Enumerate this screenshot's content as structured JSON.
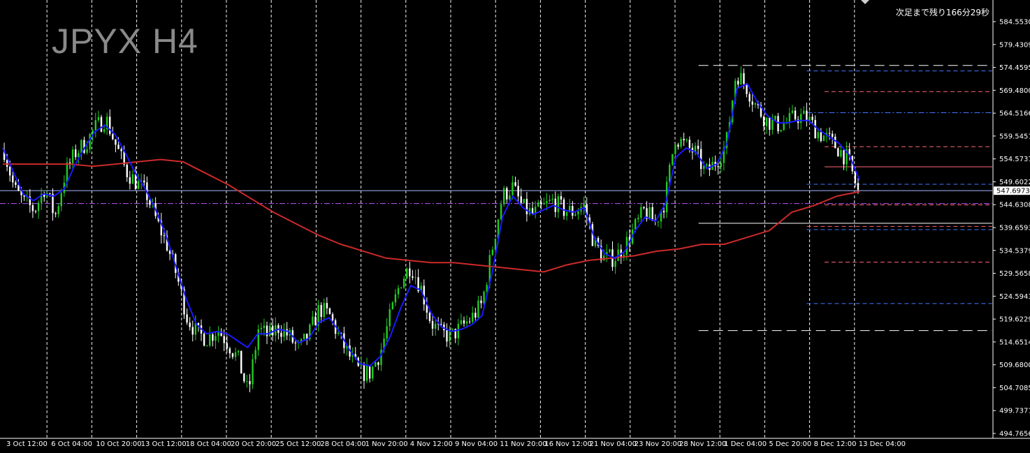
{
  "title": "JPYX H4",
  "countdown": "次足まで残り166分29秒",
  "colors": {
    "background": "#000000",
    "bull": "#22cc22",
    "bear": "#ffffff",
    "ma_fast": "#1a1aff",
    "ma_slow": "#cc2a2a",
    "grid": "#ffffff",
    "text": "#ffffff",
    "current_price_bg": "#ffffff"
  },
  "chart_data": {
    "type": "candlestick",
    "symbol": "JPYX",
    "timeframe": "H4",
    "x_labels": [
      "3 Oct 12:00",
      "6 Oct 04:00",
      "10 Oct 20:00",
      "13 Oct 12:00",
      "18 Oct 04:00",
      "20 Oct 20:00",
      "25 Oct 12:00",
      "28 Oct 04:00",
      "1 Nov 20:00",
      "4 Nov 12:00",
      "9 Nov 04:00",
      "11 Nov 20:00",
      "16 Nov 12:00",
      "21 Nov 04:00",
      "23 Nov 20:00",
      "28 Nov 12:00",
      "1 Dec 04:00",
      "5 Dec 20:00",
      "8 Dec 12:00",
      "13 Dec 04:00"
    ],
    "y_ticks": [
      "584.55305",
      "579.43095",
      "574.45950",
      "569.48005",
      "564.51660",
      "559.54515",
      "554.57370",
      "549.60225",
      "544.63080",
      "539.65935",
      "534.53795",
      "529.56580",
      "524.59435",
      "519.62290",
      "514.65145",
      "509.68000",
      "504.70855",
      "499.73710",
      "494.76565"
    ],
    "ylim": [
      494.76565,
      584.55305
    ],
    "current_price": "547.69739",
    "price_path": [
      556.5,
      548.0,
      545.0,
      543.5,
      548.5,
      542.0,
      551.5,
      556.0,
      558.0,
      561.5,
      563.5,
      557.5,
      552.0,
      549.5,
      547.0,
      541.0,
      536.0,
      529.0,
      520.0,
      516.5,
      515.5,
      517.5,
      514.5,
      511.0,
      503.5,
      517.5,
      516.0,
      518.0,
      516.0,
      513.0,
      516.5,
      522.0,
      520.5,
      515.5,
      511.5,
      508.0,
      508.0,
      512.5,
      520.5,
      528.0,
      531.5,
      526.5,
      519.0,
      516.5,
      516.0,
      518.0,
      520.0,
      523.0,
      535.0,
      546.5,
      548.5,
      544.0,
      542.5,
      544.0,
      545.5,
      543.5,
      543.0,
      544.5,
      536.5,
      533.0,
      533.0,
      535.5,
      539.5,
      543.5,
      540.5,
      545.5,
      559.5,
      557.5,
      556.0,
      551.5,
      554.0,
      557.5,
      573.5,
      570.5,
      566.0,
      563.0,
      562.0,
      562.5,
      564.0,
      563.5,
      560.5,
      559.0,
      557.0,
      554.5,
      547.5
    ],
    "ma_fast_path": [
      557.0,
      552.0,
      547.0,
      545.5,
      547.0,
      546.5,
      548.0,
      553.0,
      557.0,
      560.5,
      562.0,
      560.0,
      556.0,
      551.5,
      548.0,
      543.5,
      538.0,
      531.0,
      524.0,
      518.5,
      516.5,
      517.0,
      516.5,
      515.0,
      513.5,
      516.5,
      516.5,
      517.5,
      517.0,
      514.5,
      515.5,
      519.0,
      520.0,
      517.0,
      513.0,
      510.0,
      509.5,
      511.5,
      516.0,
      522.0,
      527.0,
      526.0,
      521.0,
      518.0,
      517.0,
      517.5,
      518.5,
      520.5,
      530.0,
      542.0,
      546.5,
      544.0,
      542.5,
      543.5,
      544.5,
      543.5,
      543.0,
      544.0,
      537.5,
      534.0,
      533.0,
      534.5,
      539.0,
      542.0,
      541.0,
      545.0,
      555.0,
      557.0,
      556.0,
      552.5,
      553.5,
      558.0,
      570.0,
      571.0,
      567.0,
      564.0,
      562.5,
      562.5,
      563.0,
      563.0,
      561.0,
      559.5,
      558.0,
      555.5,
      550.0
    ],
    "ma_slow_path": [
      553.5,
      553.5,
      553.5,
      553.5,
      553.0,
      553.5,
      554.0,
      554.5,
      554.0,
      551.5,
      549.0,
      546.0,
      543.0,
      540.5,
      538.0,
      536.0,
      534.5,
      533.0,
      532.5,
      532.0,
      532.0,
      531.5,
      531.0,
      530.5,
      530.0,
      531.5,
      532.5,
      533.0,
      533.5,
      534.5,
      535.0,
      536.0,
      536.0,
      537.5,
      539.0,
      543.0,
      544.5,
      546.5,
      547.5
    ],
    "series": [
      {
        "name": "",
        "type": "moving-average",
        "color": "#1a1aff"
      },
      {
        "name": "",
        "type": "moving-average",
        "color": "#cc2a2a"
      }
    ],
    "horizontal_levels": [
      {
        "price": 575.0,
        "style": "long-dash",
        "color": "#ffffff",
        "from": 0.704
      },
      {
        "price": 573.8,
        "style": "dash",
        "color": "#4477ff",
        "from": 0.813
      },
      {
        "price": 569.3,
        "style": "dash",
        "color": "#ff6677",
        "from": 0.831
      },
      {
        "price": 564.7,
        "style": "dash-dot",
        "color": "#4477ff",
        "from": 0.813
      },
      {
        "price": 557.3,
        "style": "dash",
        "color": "#ff6677",
        "from": 0.831
      },
      {
        "price": 552.9,
        "style": "solid",
        "color": "#ff6677",
        "from": 0.831
      },
      {
        "price": 549.1,
        "style": "dash",
        "color": "#4477ff",
        "from": 0.813
      },
      {
        "price": 547.7,
        "style": "solid",
        "color": "#aab8ff",
        "from": 0.0
      },
      {
        "price": 544.9,
        "style": "dash-dot",
        "color": "#bb55ff",
        "from": 0.0
      },
      {
        "price": 544.6,
        "style": "dash",
        "color": "#ff6677",
        "from": 0.831
      },
      {
        "price": 540.6,
        "style": "solid",
        "color": "#ffffff",
        "from": 0.704
      },
      {
        "price": 539.9,
        "style": "dash",
        "color": "#ff6677",
        "from": 0.813
      },
      {
        "price": 539.2,
        "style": "dash",
        "color": "#4477ff",
        "from": 0.813
      },
      {
        "price": 532.1,
        "style": "dash",
        "color": "#ff6677",
        "from": 0.831
      },
      {
        "price": 523.1,
        "style": "dash",
        "color": "#4477ff",
        "from": 0.813
      },
      {
        "price": 517.2,
        "style": "long-dash",
        "color": "#ffffff",
        "from": 0.704
      }
    ]
  }
}
